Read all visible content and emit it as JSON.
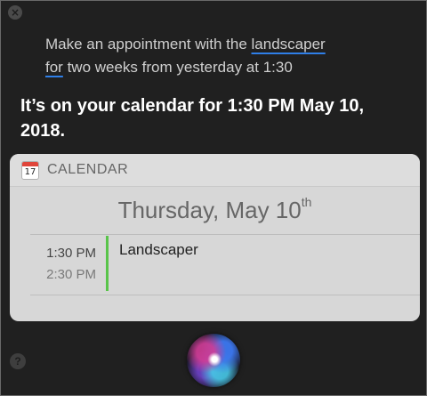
{
  "window": {
    "close_glyph": "×",
    "help_glyph": "?"
  },
  "query": {
    "part1": "Make an appointment with the ",
    "hl1": "landscaper",
    "space": " ",
    "hl2": "for",
    "part2": " two weeks from yesterday at 1:30"
  },
  "response": {
    "text": "It’s on your calendar for 1:30 PM May 10, 2018."
  },
  "card": {
    "icon_day": "17",
    "app_label": "CALENDAR",
    "date_title": "Thursday, May 10",
    "date_suffix": "th",
    "event": {
      "start": "1:30 PM",
      "end": "2:30 PM",
      "title": "Landscaper",
      "bar_color": "#59c44a"
    }
  },
  "icons": {
    "close": "close-icon",
    "help": "help-icon",
    "calendar": "calendar-icon",
    "siri": "siri-orb-icon"
  },
  "colors": {
    "background": "#202020",
    "underline_accent": "#2f7fe8",
    "card_bg": "#d7d7d7"
  }
}
